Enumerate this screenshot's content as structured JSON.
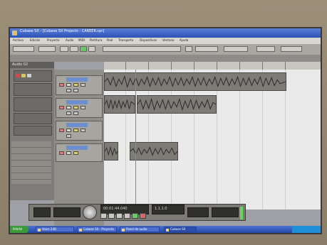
{
  "window": {
    "title": "Cubase SX - [Cubase SX Projects - CAREER.cpr]"
  },
  "menu": [
    "Archivo",
    "Edición",
    "Proyecto",
    "Audio",
    "MIDI",
    "Partitura",
    "Pool",
    "Transporte",
    "Dispositivos",
    "Ventana",
    "Ayuda"
  ],
  "inspector": {
    "title": "Audio 02"
  },
  "transport": {
    "time": "00:01:44.040",
    "position": "1.1.1.0"
  },
  "taskbar": {
    "start_label": "Inicio",
    "tasks": [
      {
        "label": "Voice 24D"
      },
      {
        "label": "Cubase SX - Proyecto"
      },
      {
        "label": "Panel de audio"
      },
      {
        "label": "Cubase SX"
      }
    ]
  },
  "colors": {
    "titlebar": "#2b51b8",
    "taskbar": "#2447a8",
    "events_bg": "#eaeaea",
    "clip": "#7e7b76"
  }
}
